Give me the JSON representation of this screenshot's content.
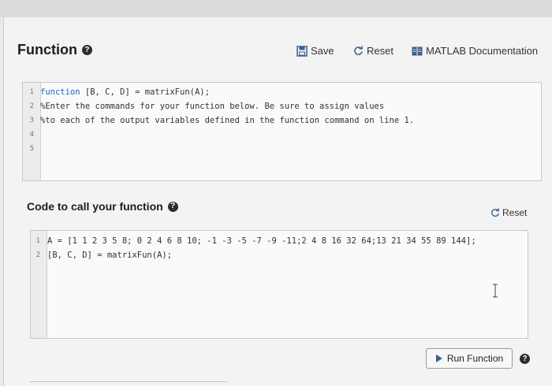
{
  "function_panel": {
    "title": "Function",
    "help_symbol": "?",
    "save_label": "Save",
    "reset_label": "Reset",
    "doc_label": "MATLAB Documentation",
    "code_lines": [
      {
        "num": "1",
        "prefix_kw": "function",
        "text": " [B, C, D] = matrixFun(A);"
      },
      {
        "num": "2",
        "prefix_kw": "",
        "text": "%Enter the commands for your function below. Be sure to assign values"
      },
      {
        "num": "3",
        "prefix_kw": "",
        "text": "%to each of the output variables defined in the function command on line 1."
      },
      {
        "num": "4",
        "prefix_kw": "",
        "text": ""
      },
      {
        "num": "5",
        "prefix_kw": "",
        "text": ""
      }
    ]
  },
  "call_panel": {
    "title": "Code to call your function",
    "reset_label": "Reset",
    "code_lines": [
      {
        "num": "1",
        "text": "A = [1 1 2 3 5 8; 0 2 4 6 8 10; -1 -3 -5 -7 -9 -11;2 4 8 16 32 64;13 21 34 55 89 144];"
      },
      {
        "num": "2",
        "text": "[B, C, D] = matrixFun(A);"
      }
    ],
    "run_label": "Run Function"
  },
  "colors": {
    "keyword": "#1d63c8",
    "icon_blue": "#3a5f8f"
  }
}
